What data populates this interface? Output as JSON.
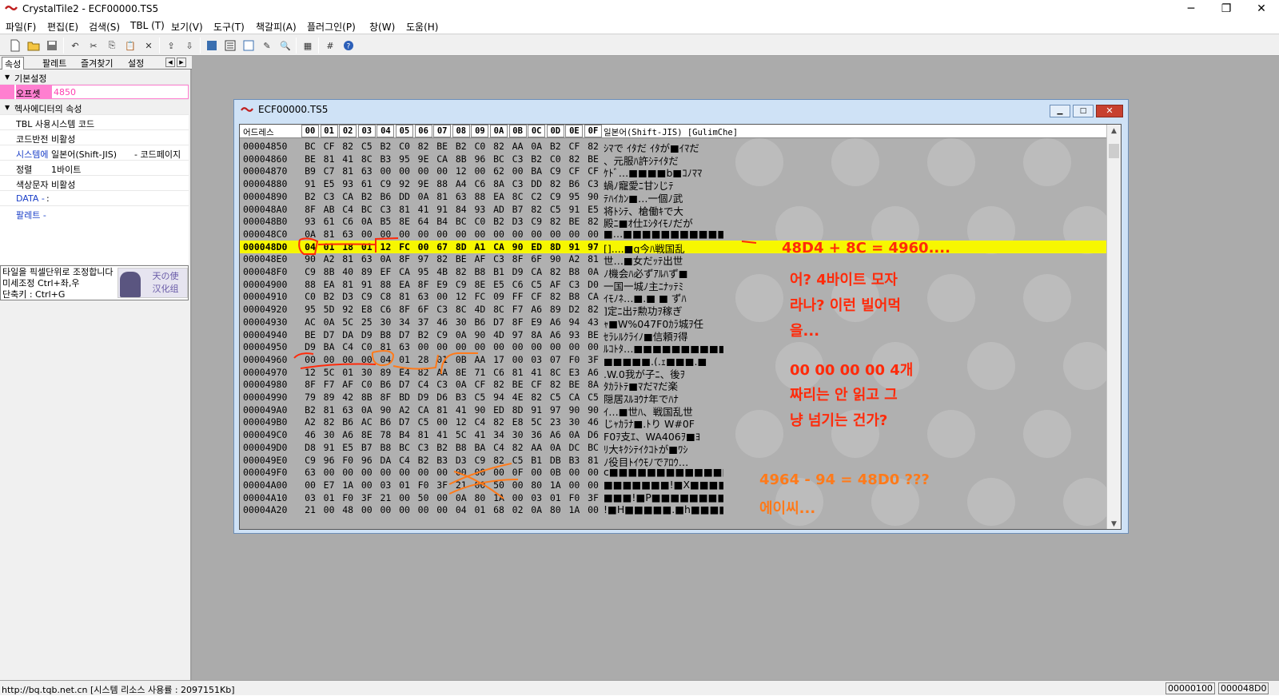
{
  "app": {
    "title": "CrystalTile2 - ECF00000.TS5",
    "minimize": "─",
    "restore": "❐",
    "close": "✕"
  },
  "menu": [
    "파일(F)",
    "편집(E)",
    "검색(S)",
    "TBL (T)",
    "보기(V)",
    "도구(T)",
    "책갈피(A)",
    "플러그인(P)",
    "창(W)",
    "도움(H)"
  ],
  "left_tabs": [
    "속성",
    "팔레트",
    "즐겨찾기",
    "설정"
  ],
  "properties": {
    "basic": "기본설정",
    "offset_key": "오프셋",
    "offset_val": "4850",
    "hex_cat": "헥사에디터의 속성",
    "rows": [
      {
        "k": "TBL 사용",
        "v": "시스템 코드",
        "v2": ""
      },
      {
        "k": "코드반전",
        "v": "비활성",
        "v2": ""
      },
      {
        "k": "시스템에",
        "v": "일본어(Shift-JIS)",
        "v2": "- 코드페이지"
      },
      {
        "k": "정렬",
        "v": "1바이트",
        "v2": ""
      },
      {
        "k": "색상문자",
        "v": "비활성",
        "v2": ""
      },
      {
        "k": "DATA -",
        "v": ":",
        "v2": ""
      },
      {
        "k": "팔레트 -",
        "v": "",
        "v2": ""
      }
    ]
  },
  "hint": {
    "l1": "타일을 픽셀단위로 조정합니다",
    "l2": "미세조정 Ctrl+좌,우",
    "l3": "단축키 : Ctrl+G",
    "logo1": "天の使",
    "logo2": "汉化组"
  },
  "child": {
    "title": "ECF00000.TS5",
    "min": "▁",
    "max": "□",
    "close": "✕"
  },
  "hex": {
    "addr_header": "어드레스",
    "cols": [
      "00",
      "01",
      "02",
      "03",
      "04",
      "05",
      "06",
      "07",
      "08",
      "09",
      "0A",
      "0B",
      "0C",
      "0D",
      "0E",
      "0F"
    ],
    "text_header": "일본어(Shift-JIS) [GulimChe]",
    "rows": [
      {
        "a": "00004850",
        "b": "BC CF 82 C5 B2 C0 82 BE B2 C0 82 AA 0A B2 CF 82",
        "t": "ｼﾏで ｲﾀだ ｲﾀが■ｲﾏだ"
      },
      {
        "a": "00004860",
        "b": "BE 81 41 8C B3 95 9E CA 8B 96 BC C3 B2 C0 82 BE",
        "t": "、元服ﾊ許ｼﾃｲﾀだ"
      },
      {
        "a": "00004870",
        "b": "B9 C7 81 63 00 00 00 00 12 00 62 00 BA C9 CF CF",
        "t": "ｹﾄﾞ…■■■■b■ｺﾉﾏﾏ"
      },
      {
        "a": "00004880",
        "b": "91 E5 93 61 C9 92 9E 88 A4 C6 8A C3 DD 82 B6 C3",
        "t": "蝸ﾉ寵愛ﾆ甘ﾝじﾃ"
      },
      {
        "a": "00004890",
        "b": "B2 C3 CA B2 B6 DD 0A 81 63 88 EA 8C C2 C9 95 90",
        "t": "ﾃﾊｲｶﾝ■…一個ﾉ武"
      },
      {
        "a": "000048A0",
        "b": "8F AB C4 BC C3 81 41 91 84 93 AD B7 82 C5 91 E5",
        "t": "将ﾄｼﾃ、槍働ｷで大"
      },
      {
        "a": "000048B0",
        "b": "93 61 C6 0A B5 8E 64 B4 BC C0 B2 D3 C9 82 BE 82",
        "t": "殿ﾆ■ｵ仕ｴｼﾀｲﾓﾉだが"
      },
      {
        "a": "000048C0",
        "b": "0A 81 63 00 00 00 00 00 00 00 00 00 00 00 00 00",
        "t": "■…■■■■■■■■■■■■■"
      },
      {
        "a": "000048D0",
        "b": "04 01 18 01 12 FC 00 67 8D A1 CA 90 ED 8D 91 97",
        "t": "[]....■g今ﾊ戦国乱",
        "sel": true
      },
      {
        "a": "000048E0",
        "b": "90 A2 81 63 0A 8F 97 82 BE AF C3 8F 6F 90 A2 81",
        "t": "世…■女だｯﾃ出世"
      },
      {
        "a": "000048F0",
        "b": "C9 8B 40 89 EF CA 95 4B 82 B8 B1 D9 CA 82 B8 0A",
        "t": "ﾉ機会ﾊ必ずｱﾙﾊず■"
      },
      {
        "a": "00004900",
        "b": "88 EA 81 91 88 EA 8F E9 C9 8E E5 C6 C5 AF C3 D0",
        "t": "一国一城ﾉ主ﾆﾅｯﾃﾐ"
      },
      {
        "a": "00004910",
        "b": "C0 B2 D3 C9 C8 81 63 00 12 FC 09 FF CF 82 B8 CA",
        "t": "ｲﾓﾉﾈ…■.■ ■ ずﾊ"
      },
      {
        "a": "00004920",
        "b": "95 5D 92 E8 C6 8F 6F C3 8C 4D 8C F7 A6 89 D2 82",
        "t": "]定ﾆ出ﾃ勲功ｦ稼ぎ"
      },
      {
        "a": "00004930",
        "b": "AC 0A 5C 25 30 34 37 46 30 B6 D7 8F E9 A6 94 43",
        "t": "ｬ■W%047F0ｶﾗ城ｦ任"
      },
      {
        "a": "00004940",
        "b": "BE D7 DA D9 B8 D7 B2 C9 0A 90 4D 97 8A A6 93 BE",
        "t": "ｾﾗﾚﾙｸﾗｲﾉ■信頼ｦ得"
      },
      {
        "a": "00004950",
        "b": "D9 BA C4 C0 81 63 00 00 00 00 00 00 00 00 00 00",
        "t": "ﾙｺﾄﾀ…■■■■■■■■■■"
      },
      {
        "a": "00004960",
        "b": "00 00 00 00 04 01 28 01 0B AA 17 00 03 07 F0 3F",
        "t": "■■■■■.(.ｪ■■■.■"
      },
      {
        "a": "00004970",
        "b": "12 5C 01 30 89 E4 82 AA 8E 71 C6 81 41 8C E3 A6",
        "t": ".W.0我が子ﾆ、後ｦ"
      },
      {
        "a": "00004980",
        "b": "8F F7 AF C0 B6 D7 C4 C3 0A CF 82 BE CF 82 BE 8A",
        "t": "ﾀｶﾗﾄﾃ■ﾏだﾏだ楽"
      },
      {
        "a": "00004990",
        "b": "79 89 42 8B 8F BD D9 D6 B3 C5 94 4E 82 C5 CA C5",
        "t": "隠居ｽﾙﾖｳﾅ年でﾊﾅ"
      },
      {
        "a": "000049A0",
        "b": "B2 81 63 0A 90 A2 CA 81 41 90 ED 8D 91 97 90 90",
        "t": "ｲ…■世ﾊ、戦国乱世"
      },
      {
        "a": "000049B0",
        "b": "A2 82 B6 AC B6 D7 C5 00 12 C4 82 E8 5C 23 30 46",
        "t": "じｬｶﾗﾅ■.ﾄり W#0F"
      },
      {
        "a": "000049C0",
        "b": "46 30 A6 8E 78 B4 81 41 5C 41 34 30 36 A6 0A D6",
        "t": "F0ｦ支ｴ、WA406ｦ■ﾖ"
      },
      {
        "a": "000049D0",
        "b": "D8 91 E5 B7 B8 BC C3 B2 B8 BA C4 82 AA 0A DC BC",
        "t": "ﾘ大ｷｸｼﾃｲｸｺﾄが■ﾜｼ"
      },
      {
        "a": "000049E0",
        "b": "C9 96 F0 96 DA C4 B2 B3 D3 C9 82 C5 B1 DB B3 81",
        "t": "ﾉ役目ﾄｲｳﾓﾉでｱﾛｳ…"
      },
      {
        "a": "000049F0",
        "b": "63 00 00 00 00 00 00 00 00 00 00 0F 00 0B 00 00",
        "t": "c■■■■■■■■■■■■■■■"
      },
      {
        "a": "00004A00",
        "b": "00 E7 1A 00 03 01 F0 3F 21 00 50 00 80 1A 00 00",
        "t": "■■■■■■■!■X■■■■■"
      },
      {
        "a": "00004A10",
        "b": "03 01 F0 3F 21 00 50 00 0A 80 1A 00 03 01 F0 3F",
        "t": "■■■!■P■■■■■■■■"
      },
      {
        "a": "00004A20",
        "b": "21 00 48 00 00 00 00 00 04 01 68 02 0A 80 1A 00",
        "t": "!■H■■■■■.■h■■■■■"
      }
    ]
  },
  "annotations": [
    "48D4 + 8C = 4960....",
    "어? 4바이트 모자",
    "라나? 이런 빌어먹",
    "을...",
    "00 00 00 00 4개",
    "짜리는 안 읽고 그",
    "냥 넘기는 건가?",
    "4964 - 94 = 48D0 ???",
    "에이씨..."
  ],
  "status": {
    "left": "http://bq.tqb.net.cn [시스템 리소스 사용률 : 2097151Kb]",
    "mid": "00000100",
    "right": "000048D0"
  },
  "colors": {
    "red": "#ff2a0a",
    "orange": "#ff7a1a",
    "selection": "#f7f700"
  }
}
